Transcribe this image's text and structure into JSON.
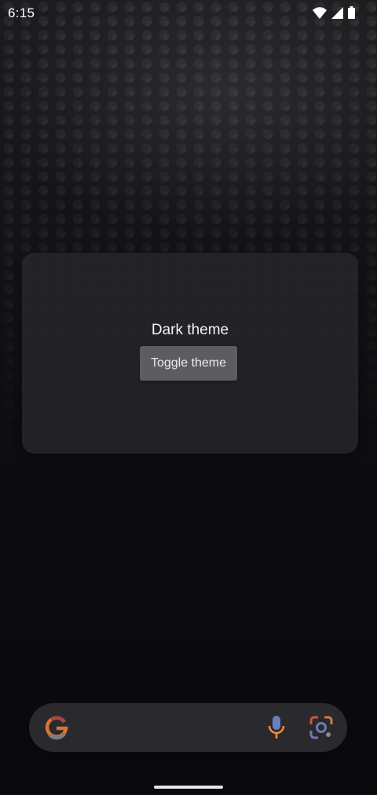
{
  "status_bar": {
    "time": "6:15",
    "icons": [
      "wifi-icon",
      "cellular-signal-icon",
      "battery-icon"
    ]
  },
  "widget": {
    "title": "Dark theme",
    "toggle_button_label": "Toggle theme"
  },
  "search_bar": {
    "icons": [
      "google-g-icon",
      "microphone-icon",
      "google-lens-icon"
    ]
  },
  "colors": {
    "widget_background": "#262529",
    "button_background": "#5d5d61",
    "google_g": "#e07a3a",
    "mic": "#f08a3c",
    "lens_accent": "#6f7ab8"
  }
}
